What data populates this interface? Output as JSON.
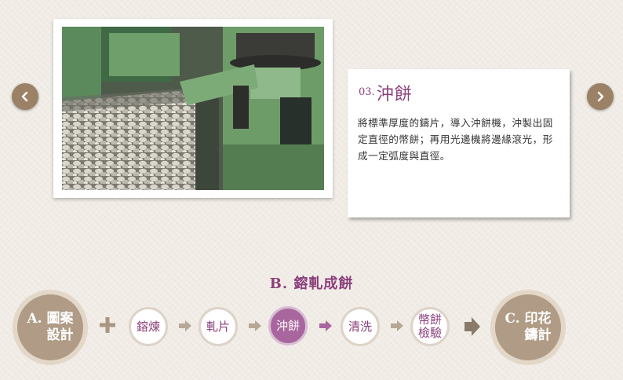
{
  "carousel": {
    "prev_icon": "chevron-left-icon",
    "next_icon": "chevron-right-icon"
  },
  "step": {
    "number": "03.",
    "name": "沖餅",
    "description": "將標準厚度的鑄片，導入沖餅機，沖製出固定直徑的幣餅；再用光邊機將邊緣滾光，形成一定弧度與直徑。"
  },
  "section": {
    "title": "B. 鎔軋成餅"
  },
  "flow": {
    "start": "A. 圖案\n設計",
    "steps": [
      "鎔煉",
      "軋片",
      "沖餅",
      "清洗",
      "幣餅\n檢驗"
    ],
    "active_index": 2,
    "end": "C. 印花\n鑄計"
  },
  "colors": {
    "accent": "#8b3f7c",
    "active": "#a9659e",
    "tan": "#b09c86"
  }
}
